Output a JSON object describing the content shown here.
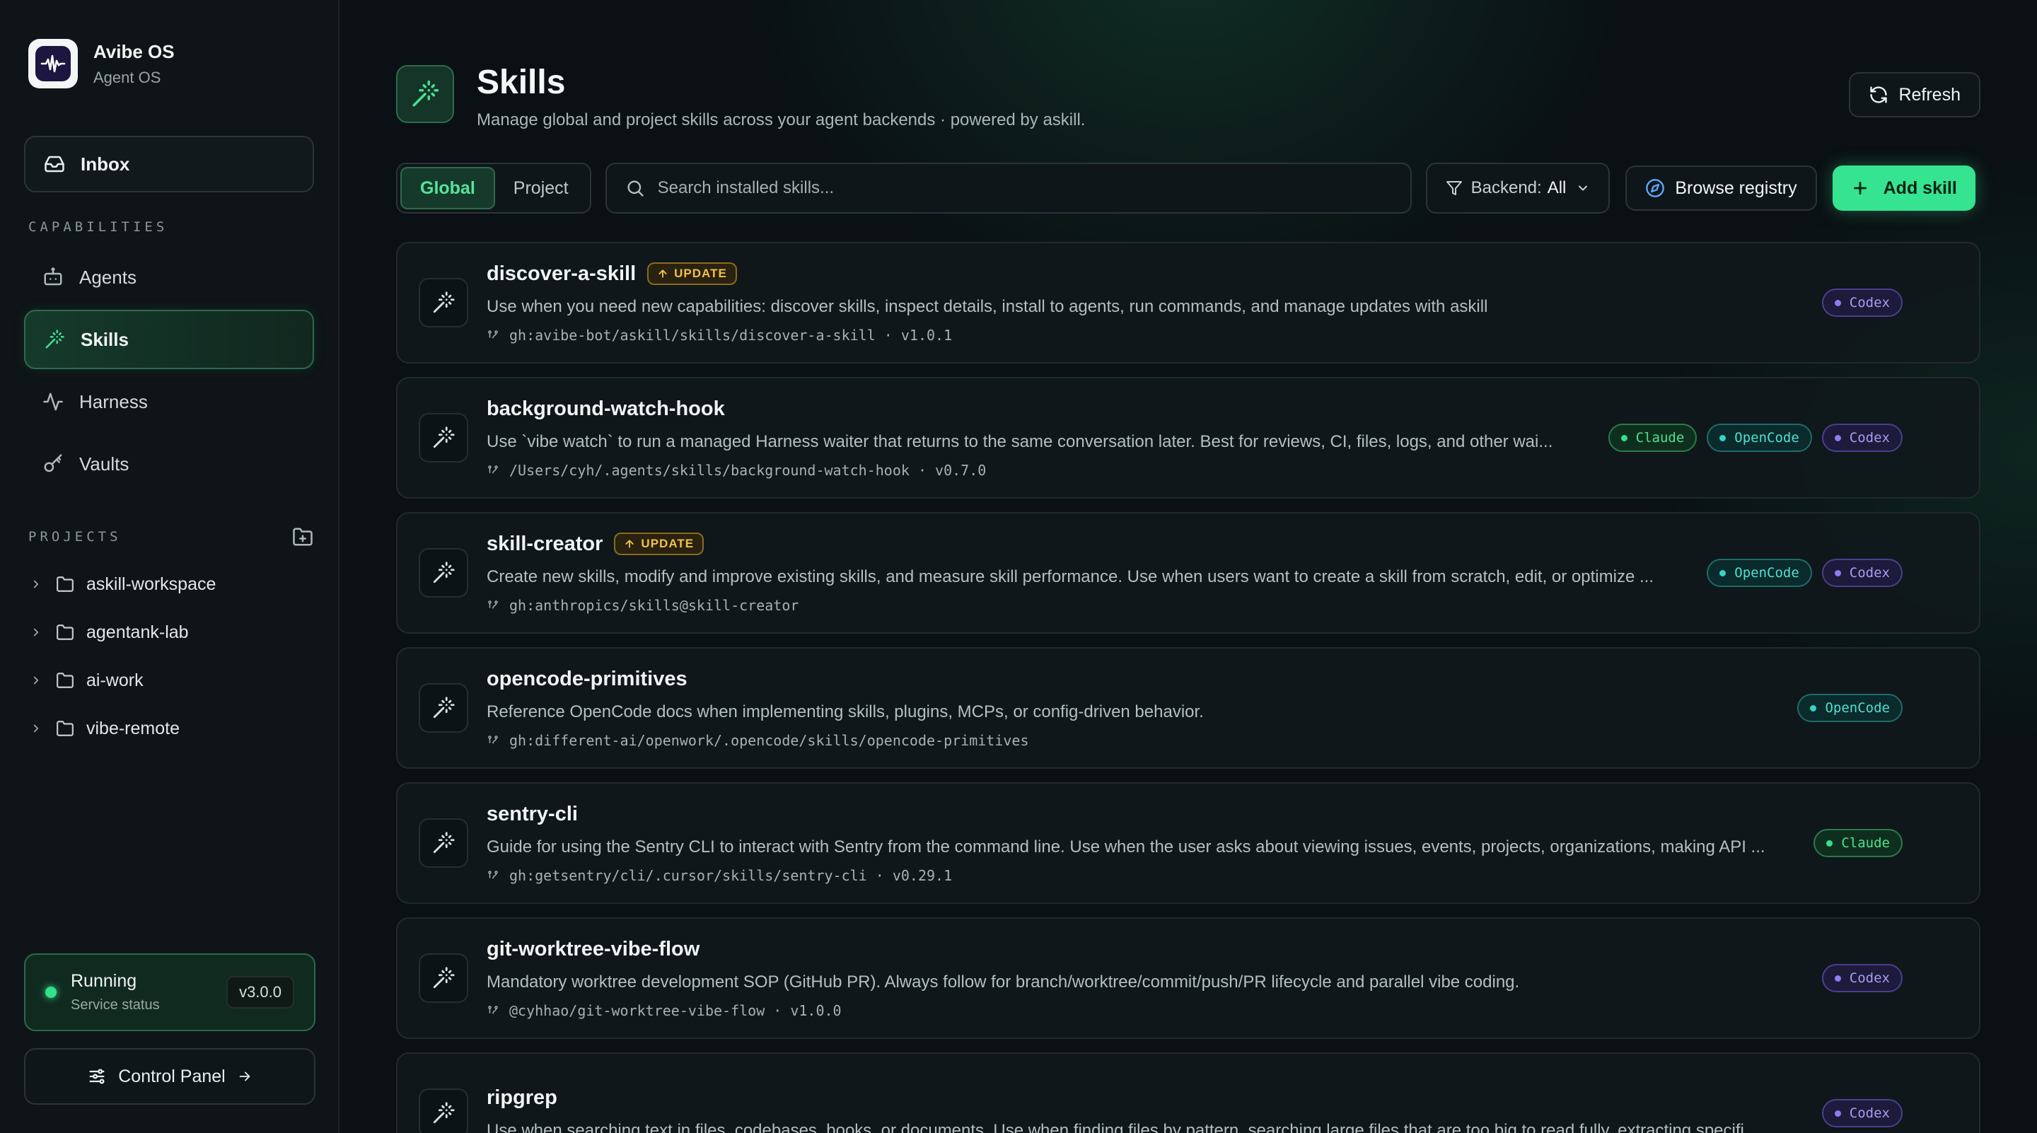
{
  "brand": {
    "title": "Avibe OS",
    "subtitle": "Agent OS"
  },
  "sidebar": {
    "inbox_label": "Inbox",
    "capabilities_label": "CAPABILITIES",
    "nav": [
      {
        "label": "Agents",
        "icon": "bot-icon",
        "active": false
      },
      {
        "label": "Skills",
        "icon": "wand-icon",
        "active": true
      },
      {
        "label": "Harness",
        "icon": "activity-icon",
        "active": false
      },
      {
        "label": "Vaults",
        "icon": "key-icon",
        "active": false
      }
    ],
    "projects_label": "PROJECTS",
    "projects": [
      "askill-workspace",
      "agentank-lab",
      "ai-work",
      "vibe-remote"
    ],
    "status": {
      "title": "Running",
      "subtitle": "Service status",
      "version": "v3.0.0"
    },
    "control_panel_label": "Control Panel"
  },
  "header": {
    "title": "Skills",
    "subtitle": "Manage global and project skills across your agent backends · powered by askill.",
    "refresh_label": "Refresh"
  },
  "toolbar": {
    "scope_tabs": [
      {
        "label": "Global",
        "active": true
      },
      {
        "label": "Project",
        "active": false
      }
    ],
    "search_placeholder": "Search installed skills...",
    "backend_label": "Backend:",
    "backend_value": "All",
    "browse_label": "Browse registry",
    "add_label": "Add skill"
  },
  "update_label": "UPDATE",
  "skills": [
    {
      "name": "discover-a-skill",
      "update": true,
      "description": "Use when you need new capabilities: discover skills, inspect details, install to agents, run commands, and manage updates with askill",
      "source": "gh:avibe-bot/askill/skills/discover-a-skill · v1.0.1",
      "backends": [
        "Codex"
      ]
    },
    {
      "name": "background-watch-hook",
      "update": false,
      "description": "Use `vibe watch` to run a managed Harness waiter that returns to the same conversation later. Best for reviews, CI, files, logs, and other wai...",
      "source": "/Users/cyh/.agents/skills/background-watch-hook · v0.7.0",
      "backends": [
        "Claude",
        "OpenCode",
        "Codex"
      ]
    },
    {
      "name": "skill-creator",
      "update": true,
      "description": "Create new skills, modify and improve existing skills, and measure skill performance. Use when users want to create a skill from scratch, edit, or optimize ...",
      "source": "gh:anthropics/skills@skill-creator",
      "backends": [
        "OpenCode",
        "Codex"
      ]
    },
    {
      "name": "opencode-primitives",
      "update": false,
      "description": "Reference OpenCode docs when implementing skills, plugins, MCPs, or config-driven behavior.",
      "source": "gh:different-ai/openwork/.opencode/skills/opencode-primitives",
      "backends": [
        "OpenCode"
      ]
    },
    {
      "name": "sentry-cli",
      "update": false,
      "description": "Guide for using the Sentry CLI to interact with Sentry from the command line. Use when the user asks about viewing issues, events, projects, organizations, making API ...",
      "source": "gh:getsentry/cli/.cursor/skills/sentry-cli · v0.29.1",
      "backends": [
        "Claude"
      ]
    },
    {
      "name": "git-worktree-vibe-flow",
      "update": false,
      "description": "Mandatory worktree development SOP (GitHub PR). Always follow for branch/worktree/commit/push/PR lifecycle and parallel vibe coding.",
      "source": "@cyhhao/git-worktree-vibe-flow · v1.0.0",
      "backends": [
        "Codex"
      ]
    },
    {
      "name": "ripgrep",
      "update": false,
      "description": "Use when searching text in files, codebases, books, or documents. Use when finding files by pattern, searching large files that are too big to read fully, extracting specifi...",
      "source": "",
      "backends": [
        "Codex"
      ]
    }
  ],
  "colors": {
    "accent": "#36e391",
    "codex": "#8e7cf0",
    "claude": "#35e08b",
    "opencode": "#34d5c6",
    "update": "#f2c14a"
  }
}
